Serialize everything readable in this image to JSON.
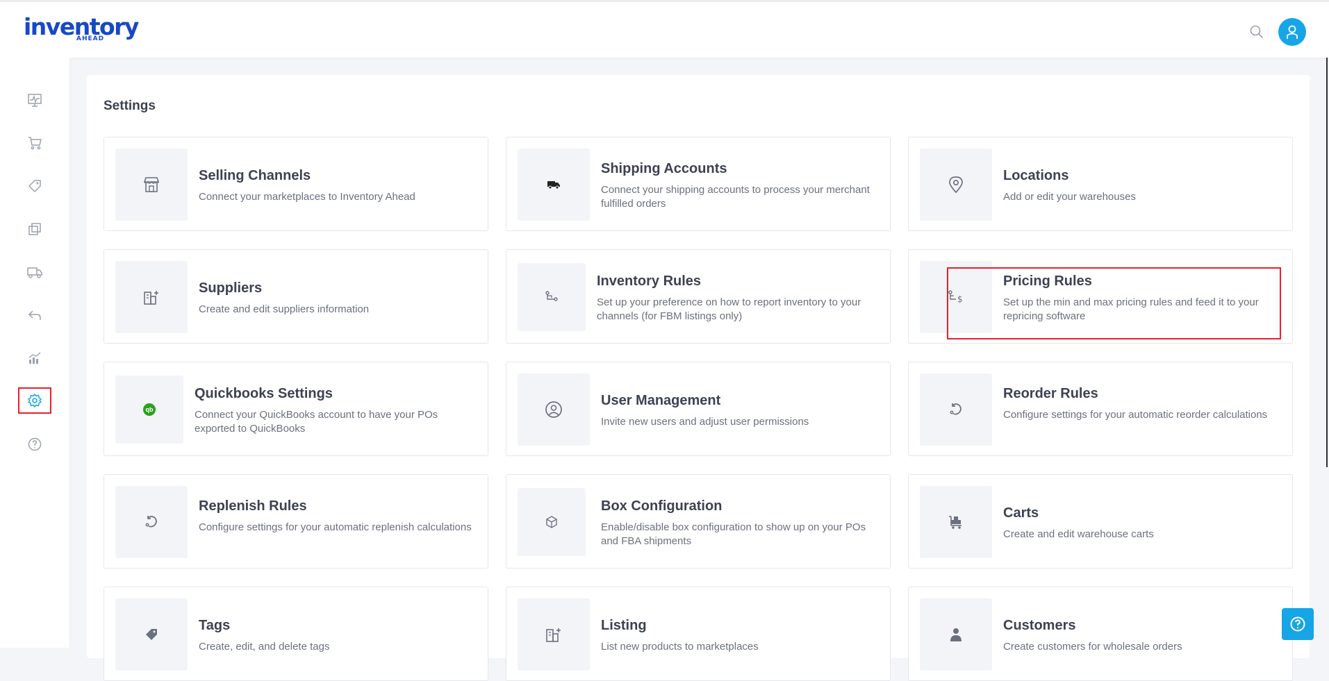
{
  "app": {
    "logo_main": "inventory",
    "logo_sub": "AHEAD"
  },
  "header": {
    "search_icon": "search-icon",
    "avatar_icon": "user-icon"
  },
  "sidebar": {
    "items": [
      {
        "id": "dashboard",
        "icon": "monitor-pulse-icon",
        "active": false
      },
      {
        "id": "orders",
        "icon": "cart-icon",
        "active": false
      },
      {
        "id": "products",
        "icon": "tag-icon",
        "active": false
      },
      {
        "id": "bundles",
        "icon": "copy-icon",
        "active": false
      },
      {
        "id": "shipments",
        "icon": "truck-icon",
        "active": false
      },
      {
        "id": "returns",
        "icon": "return-arrow-icon",
        "active": false
      },
      {
        "id": "reports",
        "icon": "chart-icon",
        "active": false
      },
      {
        "id": "settings",
        "icon": "gear-icon",
        "active": true
      },
      {
        "id": "help",
        "icon": "question-circle-icon",
        "active": false
      }
    ],
    "accent_color": "#16a5e6"
  },
  "page": {
    "title": "Settings"
  },
  "cards": [
    {
      "title": "Selling Channels",
      "description": "Connect your marketplaces to Inventory Ahead",
      "icon": "store-icon"
    },
    {
      "title": "Shipping Accounts",
      "description": "Connect your shipping accounts to process your merchant fulfilled orders",
      "icon": "truck-icon"
    },
    {
      "title": "Locations",
      "description": "Add or edit your warehouses",
      "icon": "location-pin-icon"
    },
    {
      "title": "Suppliers",
      "description": "Create and edit suppliers information",
      "icon": "building-plus-icon"
    },
    {
      "title": "Inventory Rules",
      "description": "Set up your preference on how to report inventory to your channels (for FBM listings only)",
      "icon": "flow-icon"
    },
    {
      "title": "Pricing Rules",
      "description": "Set up the min and max pricing rules and feed it to your repricing software",
      "icon": "flow-dollar-icon"
    },
    {
      "title": "Quickbooks Settings",
      "description": "Connect your QuickBooks account to have your POs exported to QuickBooks",
      "icon": "quickbooks-icon",
      "icon_text": "qb"
    },
    {
      "title": "User Management",
      "description": "Invite new users and adjust user permissions",
      "icon": "user-circle-icon"
    },
    {
      "title": "Reorder Rules",
      "description": "Configure settings for your automatic reorder calculations",
      "icon": "reload-icon"
    },
    {
      "title": "Replenish Rules",
      "description": "Configure settings for your automatic replenish calculations",
      "icon": "reload-icon"
    },
    {
      "title": "Box Configuration",
      "description": "Enable/disable box configuration to show up on your POs and FBA shipments",
      "icon": "box-icon"
    },
    {
      "title": "Carts",
      "description": "Create and edit warehouse carts",
      "icon": "cart-warehouse-icon"
    },
    {
      "title": "Tags",
      "description": "Create, edit, and delete tags",
      "icon": "tag-icon"
    },
    {
      "title": "Listing",
      "description": "List new products to marketplaces",
      "icon": "building-plus-icon"
    },
    {
      "title": "Customers",
      "description": "Create customers for wholesale orders",
      "icon": "person-icon"
    }
  ],
  "colors": {
    "highlight": "#e4212b",
    "quickbooks": "#2ca01c",
    "brand": "#1748c7"
  },
  "help_button": {
    "icon": "question-icon"
  }
}
